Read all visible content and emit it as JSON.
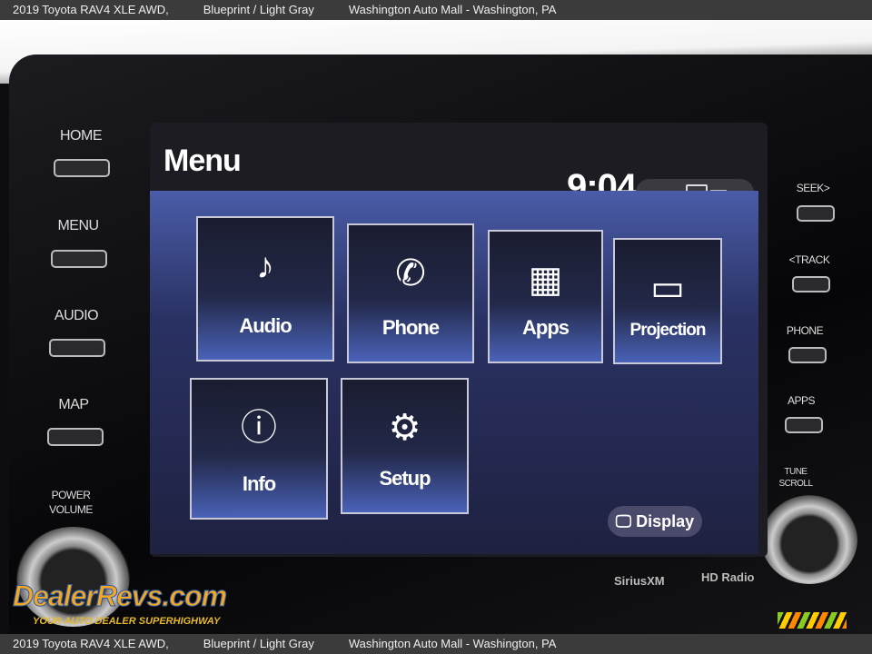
{
  "caption": {
    "vehicle": "2019 Toyota RAV4 XLE AWD,",
    "color": "Blueprint / Light Gray",
    "dealer": "Washington Auto Mall - Washington, PA"
  },
  "left_keys": [
    "HOME",
    "MENU",
    "AUDIO",
    "MAP"
  ],
  "power_volume": [
    "POWER",
    "VOLUME"
  ],
  "right_keys": [
    "SEEK>",
    "<TRACK",
    "PHONE",
    "APPS"
  ],
  "tune_scroll": [
    "TUNE",
    "SCROLL"
  ],
  "screen": {
    "title": "Menu",
    "clock": "9:04",
    "tiles": [
      {
        "label": "Audio",
        "icon": "music-note-icon",
        "glyph": "♪"
      },
      {
        "label": "Phone",
        "icon": "phone-icon",
        "glyph": "✆"
      },
      {
        "label": "Apps",
        "icon": "apps-grid-icon",
        "glyph": "▦"
      },
      {
        "label": "Projection",
        "icon": "projection-icon",
        "glyph": "▭"
      },
      {
        "label": "Info",
        "icon": "info-icon",
        "glyph": "ⓘ"
      },
      {
        "label": "Setup",
        "icon": "gear-icon",
        "glyph": "⚙"
      }
    ],
    "display_button": "Display"
  },
  "brands": {
    "siriusxm": "SiriusXM",
    "hdradio": "HD Radio"
  },
  "watermark": {
    "name": "DealerRevs.com",
    "tagline": "YOUR AUTO DEALER SUPERHIGHWAY"
  }
}
